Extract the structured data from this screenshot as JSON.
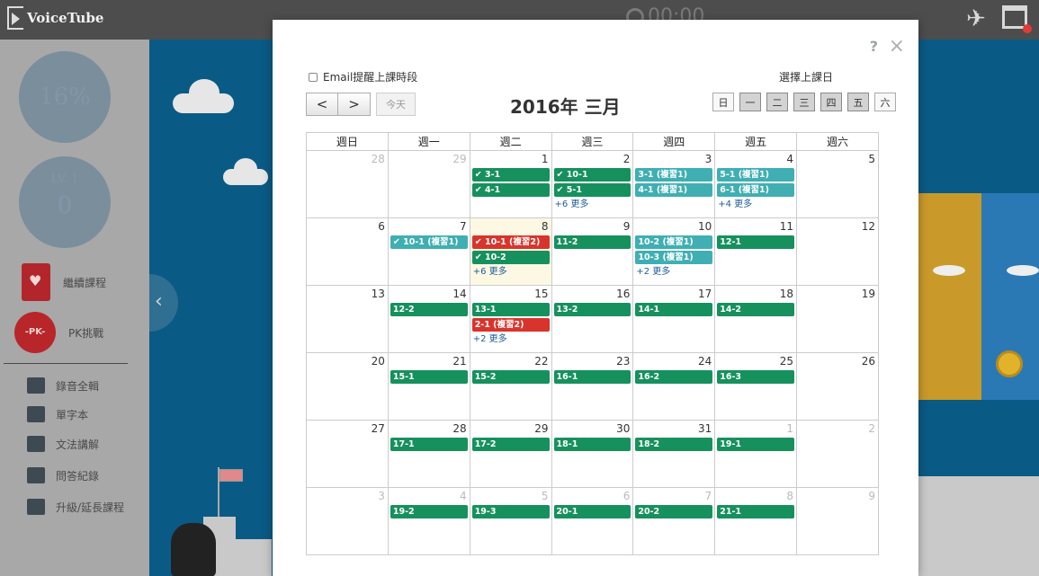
{
  "topbar": {
    "logo": "VoiceTube",
    "timer": "00:00"
  },
  "sidebar": {
    "progress": "16%",
    "level_label": "LV. 1",
    "level_value": "0",
    "continue_course": "繼續課程",
    "pk_badge": "-PK-",
    "pk_challenge": "PK挑戰",
    "items": [
      {
        "icon": "headphones-icon",
        "label": "錄音全輯"
      },
      {
        "icon": "tag-icon",
        "label": "單字本"
      },
      {
        "icon": "book-icon",
        "label": "文法講解"
      },
      {
        "icon": "id-card-icon",
        "label": "問答紀錄"
      },
      {
        "icon": "upload-icon",
        "label": "升級/延長課程"
      }
    ]
  },
  "modal": {
    "help": "?",
    "close": "×",
    "email_reminder": "Email提醒上課時段",
    "choose_days_label": "選擇上課日",
    "prev": "<",
    "next": ">",
    "today": "今天",
    "title": "2016年 三月",
    "day_buttons": [
      {
        "label": "日",
        "on": false
      },
      {
        "label": "一",
        "on": true
      },
      {
        "label": "二",
        "on": true
      },
      {
        "label": "三",
        "on": true
      },
      {
        "label": "四",
        "on": true
      },
      {
        "label": "五",
        "on": true
      },
      {
        "label": "六",
        "on": false
      }
    ],
    "weekdays": [
      "週日",
      "週一",
      "週二",
      "週三",
      "週四",
      "週五",
      "週六"
    ],
    "weeks": [
      [
        {
          "day": "28",
          "other": true,
          "events": []
        },
        {
          "day": "29",
          "other": true,
          "events": []
        },
        {
          "day": "1",
          "events": [
            {
              "label": "✔ 3-1",
              "color": "green"
            },
            {
              "label": "✔ 4-1",
              "color": "green"
            }
          ]
        },
        {
          "day": "2",
          "events": [
            {
              "label": "✔ 10-1",
              "color": "green"
            },
            {
              "label": "✔ 5-1",
              "color": "green"
            }
          ],
          "more": "+6 更多"
        },
        {
          "day": "3",
          "events": [
            {
              "label": "3-1 (複習1)",
              "color": "teal"
            },
            {
              "label": "4-1 (複習1)",
              "color": "teal"
            }
          ]
        },
        {
          "day": "4",
          "events": [
            {
              "label": "5-1 (複習1)",
              "color": "teal"
            },
            {
              "label": "6-1 (複習1)",
              "color": "teal"
            }
          ],
          "more": "+4 更多"
        },
        {
          "day": "5",
          "events": []
        }
      ],
      [
        {
          "day": "6",
          "events": []
        },
        {
          "day": "7",
          "events": [
            {
              "label": "✔ 10-1 (複習1)",
              "color": "teal"
            }
          ]
        },
        {
          "day": "8",
          "today": true,
          "events": [
            {
              "label": "✔ 10-1 (複習2)",
              "color": "red"
            },
            {
              "label": "✔ 10-2",
              "color": "green"
            }
          ],
          "more": "+6 更多"
        },
        {
          "day": "9",
          "events": [
            {
              "label": "11-2",
              "color": "green"
            }
          ]
        },
        {
          "day": "10",
          "events": [
            {
              "label": "10-2 (複習1)",
              "color": "teal"
            },
            {
              "label": "10-3 (複習1)",
              "color": "teal"
            }
          ],
          "more": "+2 更多"
        },
        {
          "day": "11",
          "events": [
            {
              "label": "12-1",
              "color": "green"
            }
          ]
        },
        {
          "day": "12",
          "events": []
        }
      ],
      [
        {
          "day": "13",
          "events": []
        },
        {
          "day": "14",
          "events": [
            {
              "label": "12-2",
              "color": "green"
            }
          ]
        },
        {
          "day": "15",
          "events": [
            {
              "label": "13-1",
              "color": "green"
            },
            {
              "label": "2-1 (複習2)",
              "color": "red"
            }
          ],
          "more": "+2 更多"
        },
        {
          "day": "16",
          "events": [
            {
              "label": "13-2",
              "color": "green"
            }
          ]
        },
        {
          "day": "17",
          "events": [
            {
              "label": "14-1",
              "color": "green"
            }
          ]
        },
        {
          "day": "18",
          "events": [
            {
              "label": "14-2",
              "color": "green"
            }
          ]
        },
        {
          "day": "19",
          "events": []
        }
      ],
      [
        {
          "day": "20",
          "events": []
        },
        {
          "day": "21",
          "events": [
            {
              "label": "15-1",
              "color": "green"
            }
          ]
        },
        {
          "day": "22",
          "events": [
            {
              "label": "15-2",
              "color": "green"
            }
          ]
        },
        {
          "day": "23",
          "events": [
            {
              "label": "16-1",
              "color": "green"
            }
          ]
        },
        {
          "day": "24",
          "events": [
            {
              "label": "16-2",
              "color": "green"
            }
          ]
        },
        {
          "day": "25",
          "events": [
            {
              "label": "16-3",
              "color": "green"
            }
          ]
        },
        {
          "day": "26",
          "events": []
        }
      ],
      [
        {
          "day": "27",
          "events": []
        },
        {
          "day": "28",
          "events": [
            {
              "label": "17-1",
              "color": "green"
            }
          ]
        },
        {
          "day": "29",
          "events": [
            {
              "label": "17-2",
              "color": "green"
            }
          ]
        },
        {
          "day": "30",
          "events": [
            {
              "label": "18-1",
              "color": "green"
            }
          ]
        },
        {
          "day": "31",
          "events": [
            {
              "label": "18-2",
              "color": "green"
            }
          ]
        },
        {
          "day": "1",
          "other": true,
          "events": [
            {
              "label": "19-1",
              "color": "green"
            }
          ]
        },
        {
          "day": "2",
          "other": true,
          "events": []
        }
      ],
      [
        {
          "day": "3",
          "other": true,
          "events": []
        },
        {
          "day": "4",
          "other": true,
          "events": [
            {
              "label": "19-2",
              "color": "green"
            }
          ]
        },
        {
          "day": "5",
          "other": true,
          "events": [
            {
              "label": "19-3",
              "color": "green"
            }
          ]
        },
        {
          "day": "6",
          "other": true,
          "events": [
            {
              "label": "20-1",
              "color": "green"
            }
          ]
        },
        {
          "day": "7",
          "other": true,
          "events": [
            {
              "label": "20-2",
              "color": "green"
            }
          ]
        },
        {
          "day": "8",
          "other": true,
          "events": [
            {
              "label": "21-1",
              "color": "green"
            }
          ]
        },
        {
          "day": "9",
          "other": true,
          "events": []
        }
      ]
    ]
  },
  "colors": {
    "green": "#16915e",
    "teal": "#3fafb3",
    "red": "#d9342b",
    "today_bg": "#fcf8e3",
    "topbar": "#4d4d4d"
  }
}
